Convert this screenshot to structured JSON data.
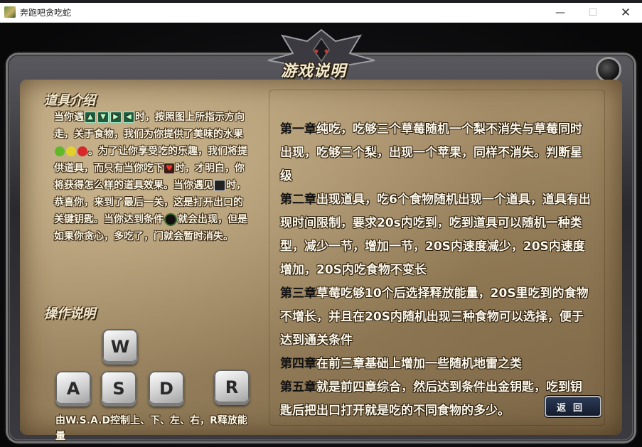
{
  "window": {
    "title": "奔跑吧贪吃蛇",
    "min_symbol": "—",
    "max_symbol": "☐",
    "close_symbol": "✕"
  },
  "page": {
    "heading": "游戏说明"
  },
  "props": {
    "title": "道具介绍",
    "p1a": "当你遇",
    "p1b": "时，按照图上所指示方向走，关于食物，我们为你提供了美味的水果",
    "p1c": "。为了让你享受吃的乐趣，我们将提供道具，而只有当你吃下",
    "p1d": "时，才明白，你将获得怎么样的道具效果。当你遇见",
    "p1e": "时，恭喜你，来到了最后一关，这是打开出口的关键钥匙。当你达到条件",
    "p1f": "就会出现，但是如果你贪心，多吃了，门就会暂时消失。"
  },
  "controls": {
    "title": "操作说明",
    "keys": [
      "W",
      "A",
      "S",
      "D",
      "R"
    ],
    "caption": "由W.S.A.D控制上、下、左、右，R释放能量"
  },
  "chapters": [
    {
      "tag": "第一章",
      "text": "纯吃，吃够三个草莓随机一个梨不消失与草莓同时出现，吃够三个梨，出现一个苹果，同样不消失。判断星级"
    },
    {
      "tag": "第二章",
      "text": "出现道具，吃6个食物随机出现一个道具，道具有出现时间限制，要求20s内吃到，吃到道具可以随机一种类型，减少一节，增加一节，20S内速度减少，20S内速度增加，20S内吃食物不变长"
    },
    {
      "tag": "第三章",
      "text": "草莓吃够10个后选择释放能量，20S里吃到的食物不增长，并且在20S内随机出现三种食物可以选择，便于达到通关条件"
    },
    {
      "tag": "第四章",
      "text": "在前三章基础上增加一些随机地雷之类"
    },
    {
      "tag": "第五章",
      "text": "就是前四章综合，然后达到条件出金钥匙，吃到钥匙后把出口打开就是吃的不同食物的多少。"
    }
  ],
  "back_button": {
    "label": "返回"
  },
  "icons": {
    "direction": [
      "arrow-up-icon",
      "arrow-down-icon",
      "arrow-right-icon",
      "arrow-left-icon"
    ],
    "fruits": [
      "apple-green",
      "pear-yellow",
      "strawberry-red"
    ],
    "colors": {
      "apple": "#5fb82a",
      "pear": "#e4d02a",
      "strawberry": "#d8262a"
    }
  }
}
